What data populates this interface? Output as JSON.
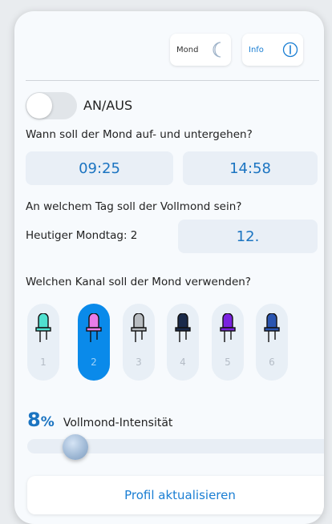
{
  "header": {
    "moon_label": "Mond",
    "info_label": "Info"
  },
  "toggle": {
    "label": "AN/AUS",
    "on": false
  },
  "rise_set": {
    "question": "Wann soll der Mond auf- und untergehen?",
    "rise_time": "09:25",
    "set_time": "14:58"
  },
  "full_moon": {
    "question": "An welchem Tag soll der Vollmond sein?",
    "today_label": "Heutiger Mondtag: 2",
    "day_value": "12."
  },
  "channel": {
    "question": "Welchen Kanal soll der Mond verwenden?",
    "selected": 2,
    "items": [
      {
        "number": "1",
        "color": "#4fe0d0"
      },
      {
        "number": "2",
        "color": "#e87ce8"
      },
      {
        "number": "3",
        "color": "#b8bcc0"
      },
      {
        "number": "4",
        "color": "#1a2a4a"
      },
      {
        "number": "5",
        "color": "#7a22e0"
      },
      {
        "number": "6",
        "color": "#2a55b0"
      }
    ]
  },
  "intensity": {
    "value": "8",
    "unit": "%",
    "label": "Vollmond-Intensität",
    "fraction": 0.08
  },
  "update_button": "Profil aktualisieren",
  "colors": {
    "accent": "#0a8aea",
    "text_blue": "#1b74c1"
  }
}
